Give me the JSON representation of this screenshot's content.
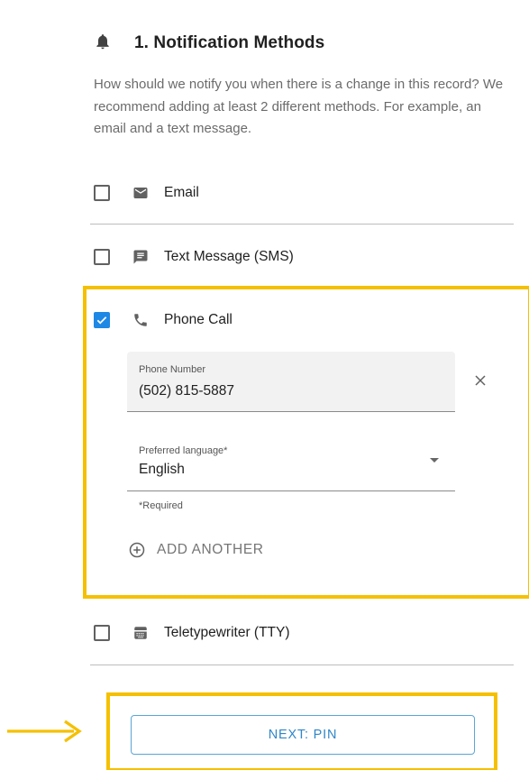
{
  "section": {
    "title": "1. Notification Methods",
    "description": "How should we notify you when there is a change in this record? We recommend adding at least 2 different methods. For example, an email and a text message."
  },
  "methods": [
    {
      "label": "Email",
      "icon": "envelope-icon",
      "checked": false
    },
    {
      "label": "Text Message (SMS)",
      "icon": "message-icon",
      "checked": false
    },
    {
      "label": "Phone Call",
      "icon": "phone-icon",
      "checked": true
    },
    {
      "label": "Teletypewriter (TTY)",
      "icon": "tty-icon",
      "checked": false
    }
  ],
  "phone_call": {
    "phone_label": "Phone Number",
    "phone_value": "(502) 815-5887",
    "language_label": "Preferred language*",
    "language_value": "English",
    "required_note": "*Required",
    "add_another_label": "ADD ANOTHER"
  },
  "next_button": {
    "label": "NEXT: PIN"
  },
  "colors": {
    "highlight": "#f5c000",
    "checkbox_checked": "#1e88e5",
    "button_text": "#2f86c8",
    "button_border": "#5aa5d6"
  }
}
